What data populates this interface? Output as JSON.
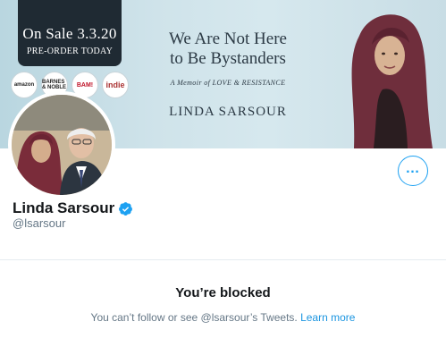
{
  "banner": {
    "sale_date": "On Sale 3.3.20",
    "preorder": "PRE-ORDER TODAY",
    "retailers": [
      "amazon",
      "BARNES & NOBLE",
      "BAM!",
      "indie"
    ],
    "book_title_line1": "We Are Not Here",
    "book_title_line2": "to Be Bystanders",
    "book_subtitle": "A Memoir of LOVE & RESISTANCE",
    "book_author": "LINDA SARSOUR"
  },
  "profile": {
    "display_name": "Linda Sarsour",
    "handle": "@lsarsour",
    "verified": true,
    "more_icon": "more-options-icon"
  },
  "blocked": {
    "title": "You’re blocked",
    "description_prefix": "You can’t follow or see @lsarsour’s Tweets.",
    "learn_more": "Learn more"
  },
  "colors": {
    "accent": "#1da1f2",
    "link": "#1b95e0",
    "muted_text": "#657786",
    "banner_dark": "#1f2a33"
  }
}
